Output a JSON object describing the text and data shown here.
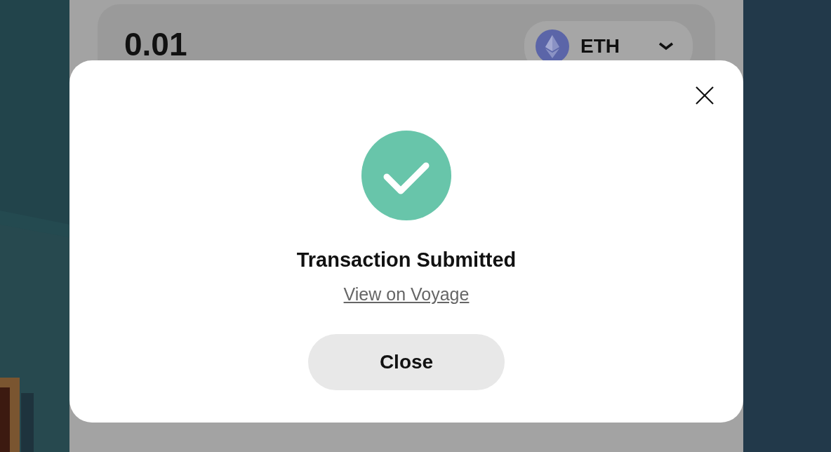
{
  "swap_card": {
    "amount": "0.01",
    "token": {
      "symbol": "ETH"
    }
  },
  "modal": {
    "success": true,
    "title": "Transaction Submitted",
    "link": "View on Voyage",
    "button": "Close"
  }
}
